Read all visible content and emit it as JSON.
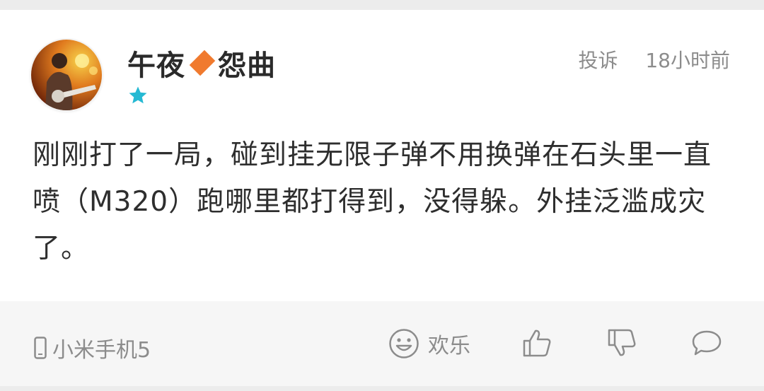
{
  "comment": {
    "username_part1": "午夜",
    "username_part2": "怨曲",
    "report_label": "投诉",
    "timestamp": "18小时前",
    "body": "刚刚打了一局，碰到挂无限子弹不用换弹在石头里一直喷（M320）跑哪里都打得到，没得躲。外挂泛滥成灾了。",
    "device_label": "小米手机5",
    "reaction_label": "欢乐"
  },
  "icons": {
    "avatar": "avatar-guitarist-photo",
    "badge": "star-icon",
    "separator": "diamond-icon",
    "device": "phone-icon",
    "reaction": "smiley-icon",
    "like": "thumbs-up-icon",
    "dislike": "thumbs-down-icon",
    "reply": "comment-bubble-icon"
  },
  "colors": {
    "star": "#25b9d3",
    "diamond": "#f07a2e",
    "text": "#2e2e2e",
    "muted": "#8c8c8c",
    "footer_bg": "#f6f6f6"
  }
}
